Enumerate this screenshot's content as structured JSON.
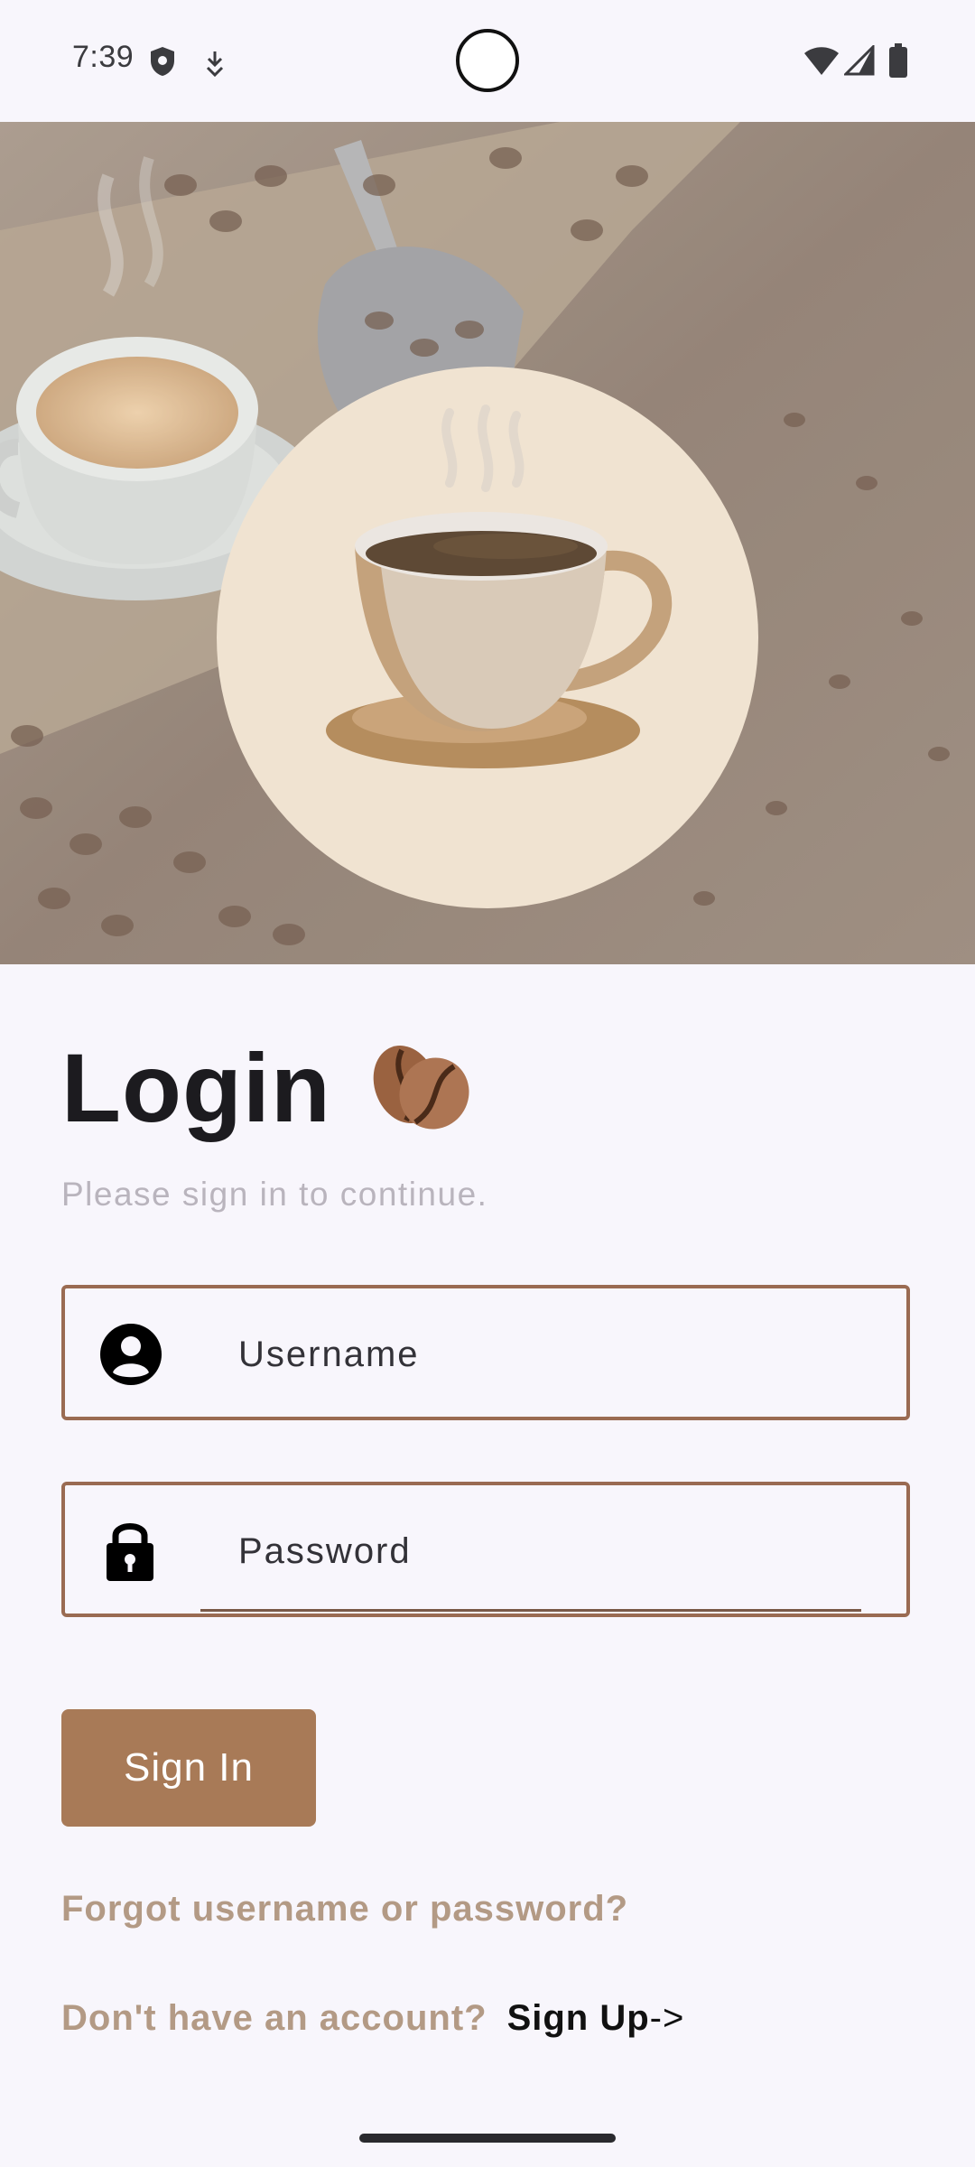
{
  "status_bar": {
    "time": "7:39",
    "icons": [
      "shield-icon",
      "download-icon",
      "wifi-icon",
      "signal-icon",
      "battery-icon"
    ]
  },
  "hero": {
    "background_image": "coffee-beans-photo",
    "logo_icon": "coffee-cup-icon"
  },
  "login": {
    "title": "Login",
    "title_icon": "coffee-beans-icon",
    "subtitle": "Please sign in to continue."
  },
  "form": {
    "username": {
      "placeholder": "Username",
      "value": "",
      "icon": "person-icon"
    },
    "password": {
      "placeholder": "Password",
      "value": "",
      "icon": "lock-icon"
    },
    "submit_label": "Sign In"
  },
  "links": {
    "forgot": "Forgot username or password?",
    "no_account": "Don't have an account?",
    "signup": "Sign Up",
    "signup_arrow": "->"
  },
  "colors": {
    "accent": "#a87a57",
    "field_border": "#9a6b52",
    "link_muted": "#b39a85",
    "background": "#f8f6fc",
    "logo_circle": "#f0e3d1"
  }
}
